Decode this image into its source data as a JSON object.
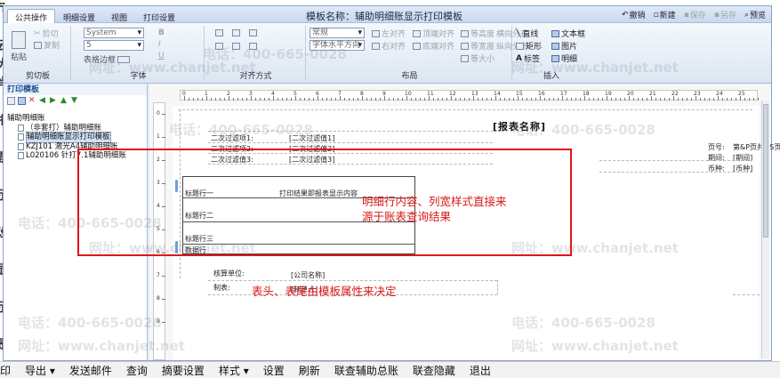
{
  "window": {
    "title": "模板名称：辅助明细账显示打印模板",
    "tabs": [
      "公共操作",
      "明细设置",
      "视图",
      "打印设置"
    ],
    "top_actions": [
      {
        "label": "撤销",
        "enabled": true
      },
      {
        "label": "新建",
        "enabled": true
      },
      {
        "label": "保存",
        "enabled": false
      },
      {
        "label": "另存",
        "enabled": false
      },
      {
        "label": "预览",
        "enabled": true
      }
    ]
  },
  "ribbon": {
    "clipboard": {
      "caption": "剪切板",
      "paste": "粘贴",
      "cut": "剪切",
      "copy": "复制"
    },
    "font": {
      "caption": "字体",
      "family": "System",
      "size": "5",
      "border_label": "表格边框",
      "bold": "B",
      "italic": "I",
      "underline": "U"
    },
    "align": {
      "caption": "对齐方式"
    },
    "layout": {
      "caption": "布局",
      "style_value": "常规",
      "halign_value": "字体水平方向",
      "buttons": [
        "左对齐",
        "顶端对齐",
        "等高度",
        "横向分布",
        "右对齐",
        "底端对齐",
        "等宽度",
        "纵向分布",
        "等大小"
      ]
    },
    "insert": {
      "caption": "插入",
      "buttons": [
        "直线",
        "文本框",
        "矩形",
        "图片",
        "标签",
        "明细"
      ]
    }
  },
  "left_pane": {
    "header": "打印模板",
    "root": "辅助明细账",
    "items": [
      "（非套打）辅助明细账",
      "辅助明细账显示打印模板",
      "KZJ101 激光A4辅助明细账",
      "L020106 针打7.1辅助明细账"
    ],
    "selected_index": 1
  },
  "designer": {
    "ruler_top": [
      "0",
      "1",
      "2",
      "3",
      "4",
      "5",
      "6",
      "7",
      "8",
      "9",
      "10",
      "11",
      "12",
      "13",
      "14",
      "15",
      "16",
      "17",
      "18",
      "19",
      "20",
      "21",
      "22",
      "23",
      "24",
      "25"
    ],
    "ruler_left": [
      "0",
      "1",
      "2",
      "3",
      "4",
      "5",
      "6",
      "7",
      "8",
      "9"
    ],
    "report_title": "[报表名称]",
    "filters": [
      {
        "label": "二次过滤项1:",
        "value": "[二次过滤值1]"
      },
      {
        "label": "二次过滤项2:",
        "value": "[二次过滤值2]"
      },
      {
        "label": "二次过滤值3:",
        "value": "[二次过滤值3]"
      }
    ],
    "right_meta": [
      {
        "label": "页号:",
        "value": "第&P页共&S页"
      },
      {
        "label": "期间:",
        "value": "[期间]"
      },
      {
        "label": "币种:",
        "value": "[币种]"
      }
    ],
    "detail_rows": [
      "标题行一",
      "标题行二",
      "标题行三",
      "数据行"
    ],
    "detail_note": "打印结果即报表显示内容",
    "footer": [
      {
        "label": "核算单位:",
        "value": "[公司名称]"
      },
      {
        "label": "制表:",
        "value": "[制单人]"
      }
    ]
  },
  "annotations": {
    "detail_note": [
      "明细行内容、列宽样式直接来",
      "源于账表查询结果"
    ],
    "header_footer_note": "表头、表尾由模板属性来决定"
  },
  "watermark": {
    "phone": "电话：400-665-0028",
    "site": "网址：www.chanjet.net"
  },
  "background_page": {
    "left_chars": [
      "fi",
      "",
      "云",
      "大",
      "肖",
      "",
      "报",
      "",
      "题",
      "",
      "示",
      "",
      "设",
      "",
      "显",
      "",
      "示",
      "",
      "是"
    ],
    "toolbar": [
      "印",
      "导出",
      "发送邮件",
      "查询",
      "摘要设置",
      "样式",
      "设置",
      "刷新",
      "联查辅助总账",
      "联查隐藏",
      "退出"
    ],
    "dropdown_items": [
      "导出",
      "样式"
    ]
  },
  "colors": {
    "annotation": "#e2141b",
    "accent": "#1a4f8f"
  }
}
